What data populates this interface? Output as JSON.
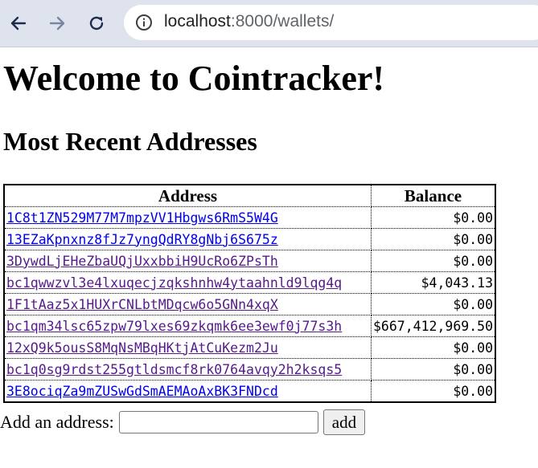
{
  "browser": {
    "url_host": "localhost",
    "url_rest": ":8000/wallets/"
  },
  "page": {
    "title": "Welcome to Cointracker!",
    "subtitle": "Most Recent Addresses"
  },
  "table": {
    "headers": {
      "address": "Address",
      "balance": "Balance"
    },
    "rows": [
      {
        "address": "1C8t1ZN529M77M7mpzVV1Hbgws6RmS5W4G",
        "balance": "$0.00",
        "visited": false
      },
      {
        "address": "13EZaKpnxnz8fJz7yngQdRY8gNbj6S675z",
        "balance": "$0.00",
        "visited": false
      },
      {
        "address": "3DywdLjEHeZbaUQjUxxbbiH9UcRo6ZPsTh",
        "balance": "$0.00",
        "visited": true
      },
      {
        "address": "bc1qwwzvl3e4lxuqecjzqkshnhw4ytaahnld9lqg4q",
        "balance": "$4,043.13",
        "visited": true
      },
      {
        "address": "1F1tAaz5x1HUXrCNLbtMDqcw6o5GNn4xqX",
        "balance": "$0.00",
        "visited": true
      },
      {
        "address": "bc1qm34lsc65zpw79lxes69zkqmk6ee3ewf0j77s3h",
        "balance": "$667,412,969.50",
        "visited": true
      },
      {
        "address": "12xQ9k5ousS8MqNsMBqHKtjAtCuKezm2Ju",
        "balance": "$0.00",
        "visited": true
      },
      {
        "address": "bc1q0sg9rdst255gtldsmcf8rk0764avqy2h2ksqs5",
        "balance": "$0.00",
        "visited": true
      },
      {
        "address": "3E8ociqZa9mZUSwGdSmAEMAoAxBK3FNDcd",
        "balance": "$0.00",
        "visited": false
      }
    ]
  },
  "form": {
    "label": "Add an address:",
    "input_value": "",
    "button_label": "add"
  },
  "colors": {
    "link": "#0000ee",
    "link_visited": "#551a8b",
    "browser_bar": "#dee3ee"
  }
}
